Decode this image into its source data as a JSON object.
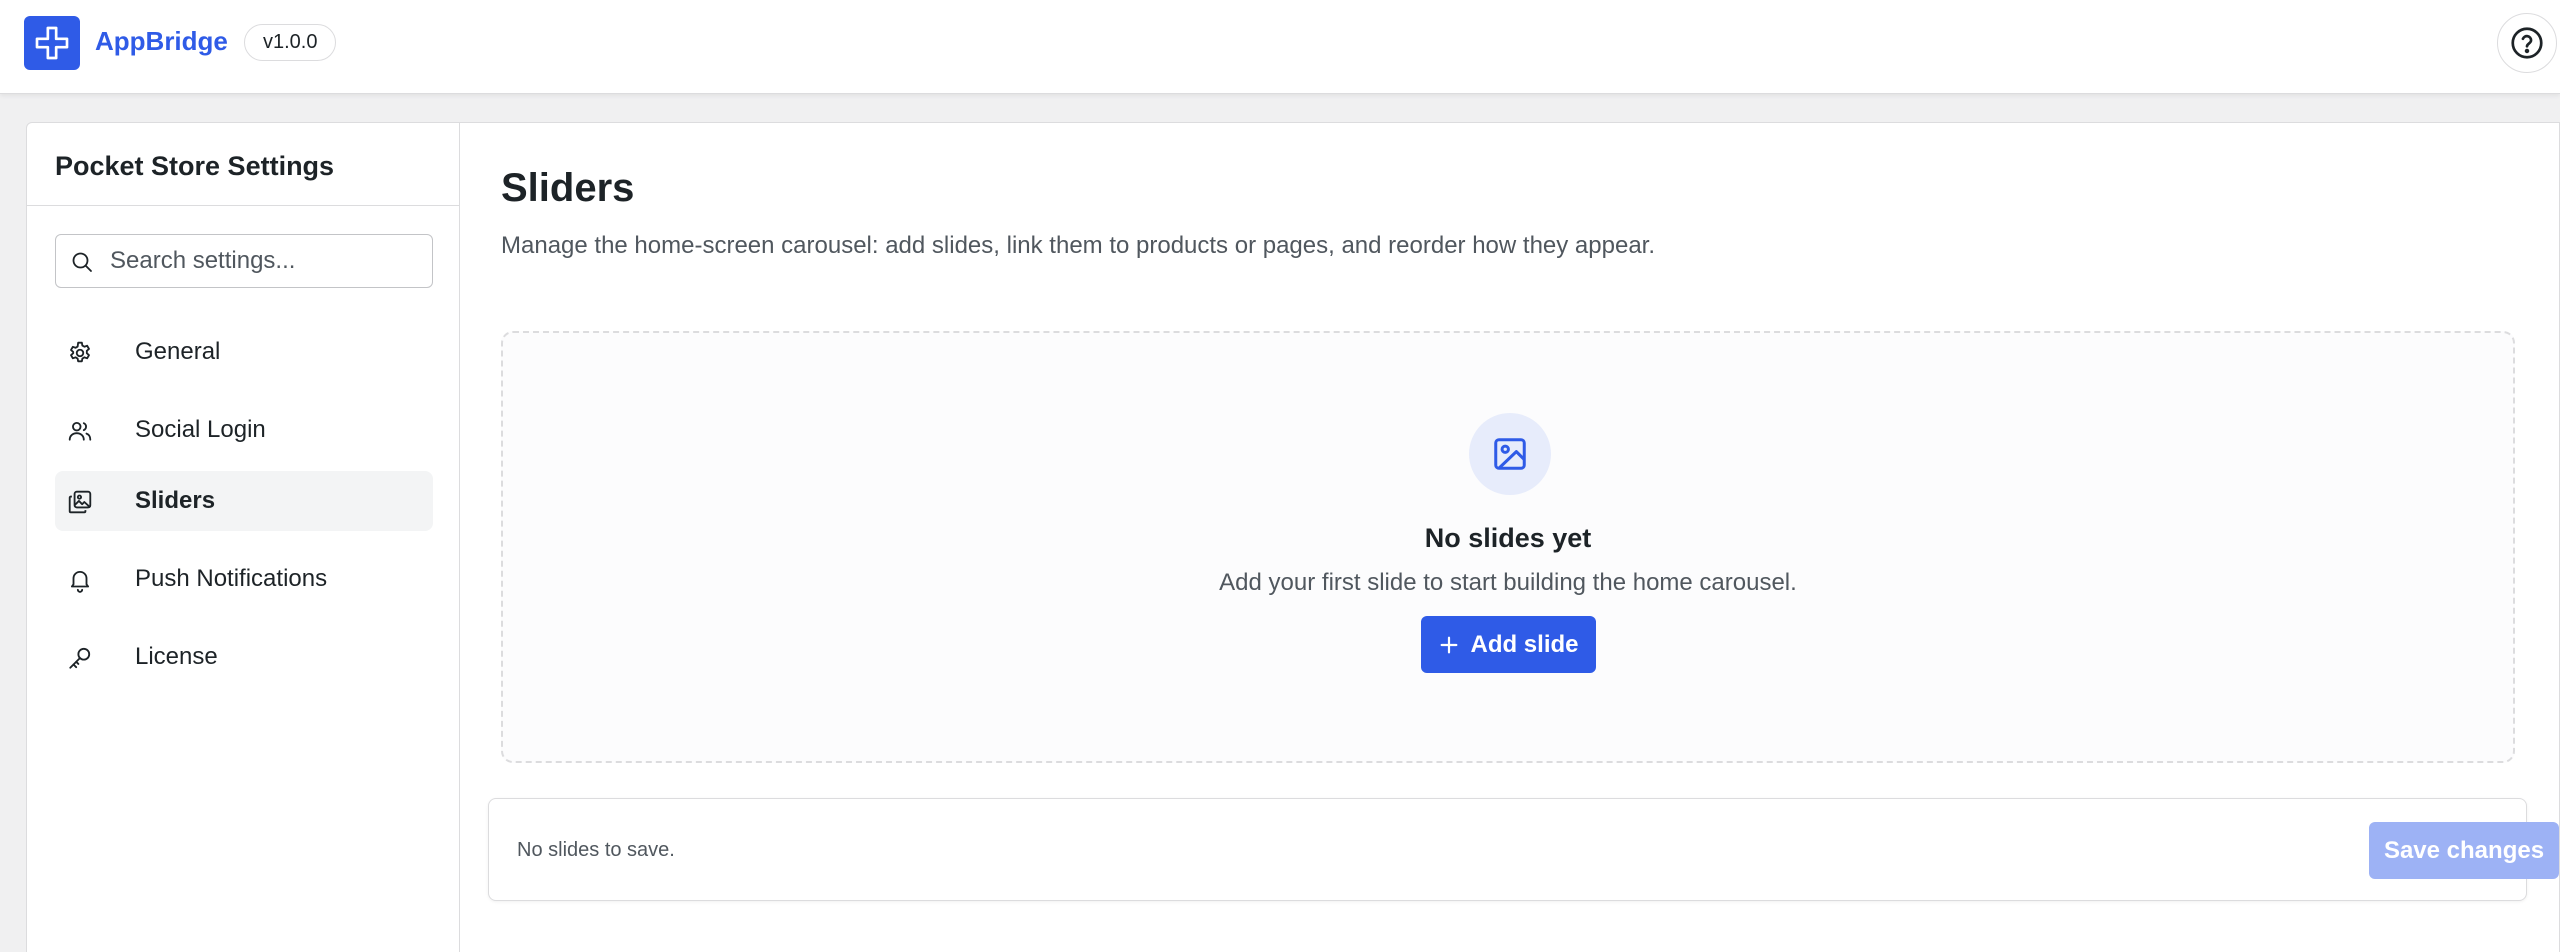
{
  "header": {
    "brand": "AppBridge",
    "version": "v1.0.0",
    "accent_color": "#2f5be7",
    "icons": {
      "logo": "plus-cross-logo-icon",
      "help": "help-circle-icon"
    }
  },
  "sidebar": {
    "title": "Pocket Store Settings",
    "search": {
      "placeholder": "Search settings...",
      "value": ""
    },
    "items": [
      {
        "label": "General",
        "icon": "gear-icon",
        "active": false
      },
      {
        "label": "Social Login",
        "icon": "users-icon",
        "active": false
      },
      {
        "label": "Sliders",
        "icon": "images-icon",
        "active": true
      },
      {
        "label": "Push Notifications",
        "icon": "bell-icon",
        "active": false
      },
      {
        "label": "License",
        "icon": "key-icon",
        "active": false
      }
    ]
  },
  "main": {
    "title": "Sliders",
    "description": "Manage the home-screen carousel: add slides, link them to products or pages, and reorder how they appear.",
    "empty_state": {
      "icon": "image-icon",
      "title": "No slides yet",
      "description": "Add your first slide to start building the home carousel.",
      "button_label": "Add slide"
    },
    "footer": {
      "status": "No slides to save.",
      "save_label": "Save changes",
      "save_disabled": true
    }
  }
}
